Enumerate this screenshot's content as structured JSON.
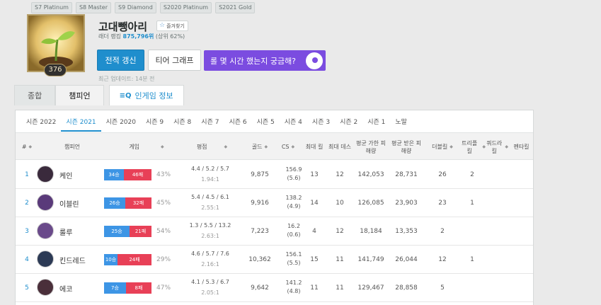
{
  "season_badges": [
    "S7 Platinum",
    "S8 Master",
    "S9 Diamond",
    "S2020 Platinum",
    "S2021 Gold"
  ],
  "profile": {
    "level": "376",
    "name": "고대뺑아리",
    "favorite_label": "즐겨찾기",
    "ladder_rank_prefix": "래더 랭킹",
    "ladder_rank_value": "875,796위",
    "ladder_rank_suffix": "(상위 62%)",
    "last_update": "최근 업데이트: 14분 전"
  },
  "buttons": {
    "renew": "전적 갱신",
    "tier_graph": "티어 그래프",
    "promo": "롤 몇 시간 했는지 궁금해?"
  },
  "main_tabs": [
    "종합",
    "챔피언",
    "인게임 정보"
  ],
  "season_tabs": [
    "시즌 2022",
    "시즌 2021",
    "시즌 2020",
    "시즌 9",
    "시즌 8",
    "시즌 7",
    "시즌 6",
    "시즌 5",
    "시즌 4",
    "시즌 3",
    "시즌 2",
    "시즌 1",
    "노말"
  ],
  "active_season_tab": "시즌 2021",
  "table": {
    "headers": {
      "num": "#",
      "champion": "챔피언",
      "games": "게임",
      "kda": "평점",
      "gold": "골드",
      "cs": "CS",
      "max_kills": "최대 킬",
      "max_deaths": "최대 데스",
      "avg_dealt": "평균 가한 피해량",
      "avg_taken": "평균 받은 피해량",
      "double": "더블킬",
      "triple": "트리플 킬",
      "quadra": "쿼드라 킬",
      "penta": "펜타킬"
    },
    "rows": [
      {
        "rank": "1",
        "champion": "케인",
        "wins": "34승",
        "losses": "46패",
        "win_fraction": 0.425,
        "win_pct": "43%",
        "kda": "4.4 / 5.2 / 5.7",
        "kda_ratio": "1.94:1",
        "gold": "9,875",
        "cs": "156.9",
        "cs_per_min": "(5.6)",
        "max_kills": "13",
        "max_deaths": "12",
        "avg_dealt": "142,053",
        "avg_taken": "28,731",
        "double": "26",
        "triple": "2",
        "quadra": "",
        "penta": "",
        "avatar_color": "#3a2a3c"
      },
      {
        "rank": "2",
        "champion": "이블린",
        "wins": "26승",
        "losses": "32패",
        "win_fraction": 0.45,
        "win_pct": "45%",
        "kda": "5.4 / 4.5 / 6.1",
        "kda_ratio": "2.55:1",
        "gold": "9,916",
        "cs": "138.2",
        "cs_per_min": "(4.9)",
        "max_kills": "14",
        "max_deaths": "10",
        "avg_dealt": "126,085",
        "avg_taken": "23,903",
        "double": "23",
        "triple": "1",
        "quadra": "",
        "penta": "",
        "avatar_color": "#5a3a7a"
      },
      {
        "rank": "3",
        "champion": "룰루",
        "wins": "25승",
        "losses": "21패",
        "win_fraction": 0.54,
        "win_pct": "54%",
        "kda": "1.3 / 5.5 / 13.2",
        "kda_ratio": "2.63:1",
        "gold": "7,223",
        "cs": "16.2",
        "cs_per_min": "(0.6)",
        "max_kills": "4",
        "max_deaths": "12",
        "avg_dealt": "18,184",
        "avg_taken": "13,353",
        "double": "2",
        "triple": "",
        "quadra": "",
        "penta": "",
        "avatar_color": "#6a4a8a"
      },
      {
        "rank": "4",
        "champion": "킨드레드",
        "wins": "10승",
        "losses": "24패",
        "win_fraction": 0.29,
        "win_pct": "29%",
        "kda": "4.6 / 5.7 / 7.6",
        "kda_ratio": "2.16:1",
        "gold": "10,362",
        "cs": "156.1",
        "cs_per_min": "(5.5)",
        "max_kills": "15",
        "max_deaths": "11",
        "avg_dealt": "141,749",
        "avg_taken": "26,044",
        "double": "12",
        "triple": "1",
        "quadra": "",
        "penta": "",
        "avatar_color": "#2c3a55"
      },
      {
        "rank": "5",
        "champion": "에코",
        "wins": "7승",
        "losses": "8패",
        "win_fraction": 0.47,
        "win_pct": "47%",
        "kda": "4.1 / 5.3 / 6.7",
        "kda_ratio": "2.05:1",
        "gold": "9,642",
        "cs": "141.2",
        "cs_per_min": "(4.8)",
        "max_kills": "11",
        "max_deaths": "11",
        "avg_dealt": "129,467",
        "avg_taken": "28,858",
        "double": "5",
        "triple": "",
        "quadra": "",
        "penta": "",
        "avatar_color": "#4a2f3a"
      }
    ]
  },
  "colors": {
    "accent": "#1f8ecd",
    "win": "#3d95e5",
    "loss": "#e84057",
    "promo": "#7b4ce0"
  }
}
